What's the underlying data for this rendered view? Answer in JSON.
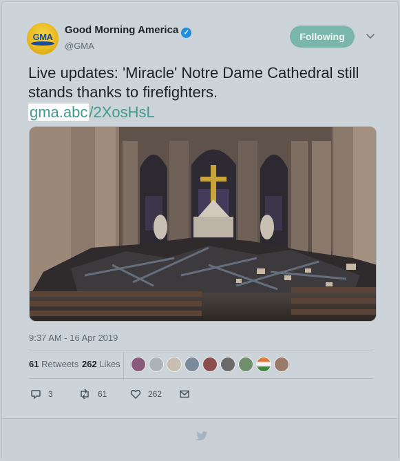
{
  "tweet": {
    "author_name": "Good Morning America",
    "handle": "@GMA",
    "avatar_text": "GMA",
    "follow_label": "Following",
    "text": "Live updates: 'Miracle' Notre Dame Cathedral still stands thanks to firefighters.",
    "link_part1": "gma.abc",
    "link_part2": "/2XosHsL",
    "timestamp": "9:37 AM - 16 Apr 2019",
    "retweets_count": "61",
    "retweets_label": "Retweets",
    "likes_count": "262",
    "likes_label": "Likes",
    "reply_count": "3",
    "retweet_action_count": "61",
    "like_action_count": "262"
  },
  "colors": {
    "follow_button": "#7bb6ad",
    "link": "#3f9a8f",
    "verified": "#1d8ee0"
  },
  "icons": {
    "verified": "verified-badge-icon",
    "menu": "chevron-down-icon",
    "reply": "reply-icon",
    "retweet": "retweet-icon",
    "like": "heart-icon",
    "dm": "envelope-icon",
    "footer": "twitter-bird-icon"
  }
}
